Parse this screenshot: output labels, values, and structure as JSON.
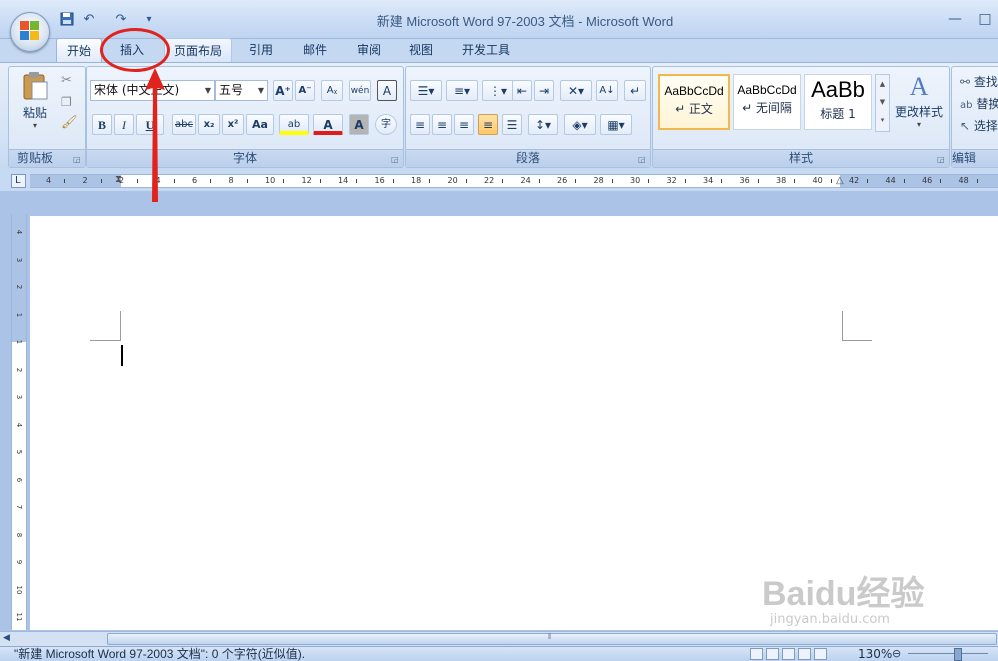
{
  "window": {
    "title": "新建 Microsoft Word 97-2003 文档 - Microsoft Word",
    "minimize": "—",
    "maximize": "□",
    "quick_access": [
      "💾",
      "↶",
      "↷",
      "▾"
    ]
  },
  "tabs": [
    {
      "label": "开始",
      "active": true
    },
    {
      "label": "插入",
      "active": false
    },
    {
      "label": "页面布局",
      "active": false
    },
    {
      "label": "引用",
      "active": false
    },
    {
      "label": "邮件",
      "active": false
    },
    {
      "label": "审阅",
      "active": false
    },
    {
      "label": "视图",
      "active": false
    },
    {
      "label": "开发工具",
      "active": false
    }
  ],
  "clipboard": {
    "group_label": "剪贴板",
    "paste_label": "粘贴",
    "cut_icon": "scissors-icon",
    "copy_icon": "copy-icon",
    "format_painter_icon": "brush-icon"
  },
  "font": {
    "group_label": "字体",
    "font_name": "宋体 (中文正文)",
    "font_size": "五号",
    "grow": "A⁺",
    "shrink": "A⁻",
    "clear_format": "Aᵪ",
    "phonetic": "wén",
    "char_border": "A",
    "bold": "B",
    "italic": "I",
    "underline": "U",
    "strike": "abc",
    "subscript": "x₂",
    "superscript": "x²",
    "change_case": "Aa",
    "highlight": "ab",
    "font_color": "A",
    "char_shading": "A",
    "enclose": "字"
  },
  "paragraph": {
    "group_label": "段落"
  },
  "styles": {
    "group_label": "样式",
    "items": [
      {
        "sample": "AaBbCcDd",
        "name": "↵ 正文",
        "selected": true
      },
      {
        "sample": "AaBbCcDd",
        "name": "↵ 无间隔",
        "selected": false
      },
      {
        "sample": "AaBb",
        "name": "标题 1",
        "selected": false
      }
    ],
    "change_styles": "更改样式"
  },
  "editing": {
    "group_label": "编辑",
    "find": "查找",
    "replace": "替换",
    "select": "选择"
  },
  "ruler": {
    "h_labels": [
      "4",
      "2",
      "2",
      "4",
      "6",
      "8",
      "10",
      "12",
      "14",
      "16",
      "18",
      "20",
      "22",
      "24",
      "26",
      "28",
      "30",
      "32",
      "34",
      "36",
      "38",
      "40",
      "42",
      "44",
      "46",
      "48"
    ],
    "v_labels": [
      "4",
      "3",
      "2",
      "1",
      "1",
      "2",
      "3",
      "4",
      "5",
      "6",
      "7",
      "8",
      "9",
      "10",
      "11"
    ]
  },
  "status": {
    "text": "\"新建 Microsoft Word 97-2003 文档\": 0 个字符(近似值).",
    "zoom": "130%"
  },
  "watermark": {
    "brand": "Baidu经验",
    "url": "jingyan.baidu.com"
  }
}
